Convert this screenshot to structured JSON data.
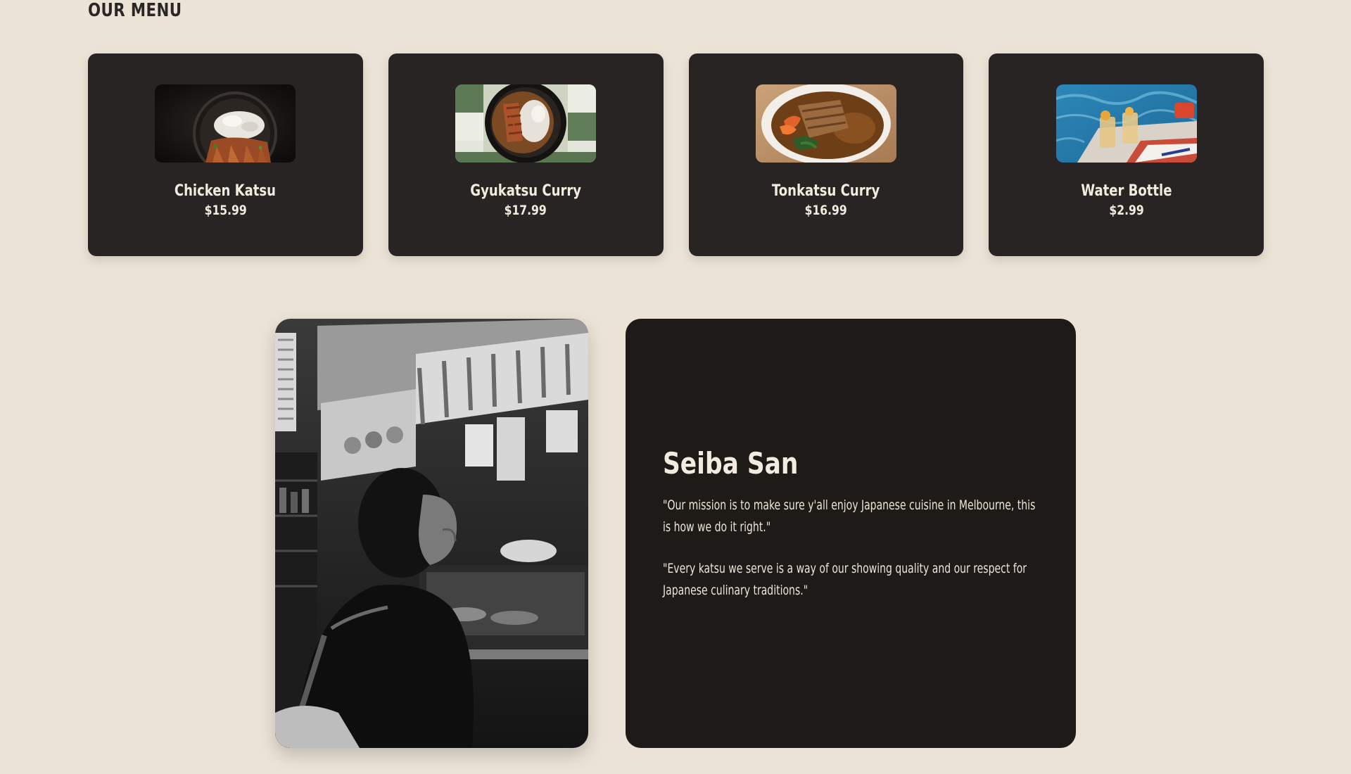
{
  "menu": {
    "title": "OUR MENU",
    "items": [
      {
        "name": "Chicken Katsu",
        "price": "$15.99",
        "image_icon": "chicken-katsu-photo"
      },
      {
        "name": "Gyukatsu Curry",
        "price": "$17.99",
        "image_icon": "gyukatsu-curry-photo"
      },
      {
        "name": "Tonkatsu Curry",
        "price": "$16.99",
        "image_icon": "tonkatsu-curry-photo"
      },
      {
        "name": "Water Bottle",
        "price": "$2.99",
        "image_icon": "water-bottle-photo"
      }
    ]
  },
  "about": {
    "name": "Seiba San",
    "quotes": [
      "\"Our mission is to make sure y'all enjoy Japanese cuisine in Melbourne, this is how we do it right.\"",
      "\"Every katsu we serve is a way of our showing quality and our respect for Japanese culinary traditions.\""
    ],
    "photo_icon": "street-food-stall-photo"
  },
  "colors": {
    "page_background": "#ebe3d6",
    "card_background": "#272423",
    "about_background": "#1d1a18",
    "text_light": "#f1ebe0",
    "text_dark": "#2a2624"
  }
}
